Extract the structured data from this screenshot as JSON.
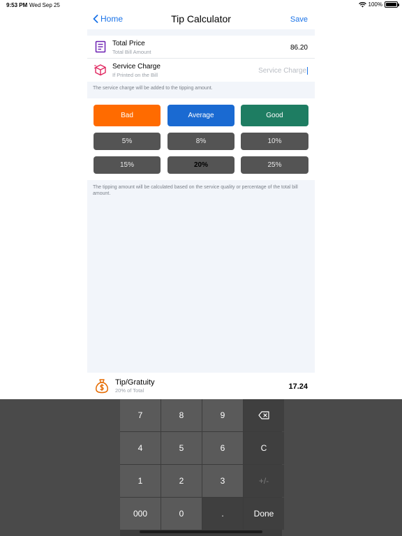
{
  "status": {
    "time": "9:53 PM",
    "date": "Wed Sep 25",
    "battery": "100%"
  },
  "nav": {
    "back_label": "Home",
    "title": "Tip Calculator",
    "save_label": "Save"
  },
  "fields": {
    "total_price": {
      "title": "Total Price",
      "subtitle": "Total Bill Amount",
      "value": "86.20"
    },
    "service_charge": {
      "title": "Service Charge",
      "subtitle": "If Printed on the Bill",
      "placeholder": "Service Charge"
    }
  },
  "notes": {
    "service_note": "The service charge will be added to the tipping amount.",
    "tipping_note": "The tipping amount will be calculated based on the service quality or percentage of the total bill amount."
  },
  "quality": {
    "bad": {
      "label": "Bad",
      "color": "#ff6b00"
    },
    "average": {
      "label": "Average",
      "color": "#1a6ad2"
    },
    "good": {
      "label": "Good",
      "color": "#1e7d62"
    }
  },
  "percentages": [
    "5%",
    "8%",
    "10%",
    "15%",
    "20%",
    "25%"
  ],
  "selected_percentage": "20%",
  "tip": {
    "title": "Tip/Gratuity",
    "subtitle": "20% of Total",
    "value": "17.24"
  },
  "keypad": {
    "k7": "7",
    "k8": "8",
    "k9": "9",
    "k4": "4",
    "k5": "5",
    "k6": "6",
    "kc": "C",
    "k1": "1",
    "k2": "2",
    "k3": "3",
    "kpm": "+/-",
    "k000": "000",
    "k0": "0",
    "kdot": ".",
    "kdone": "Done"
  },
  "icons": {
    "receipt": "receipt-icon",
    "box": "package-icon",
    "money_bag": "money-bag-icon",
    "backspace": "backspace-icon"
  },
  "colors": {
    "accent": "#1a73e8",
    "receipt_icon": "#6b1fb1",
    "box_icon": "#e0245e",
    "money_icon": "#e56a00"
  }
}
